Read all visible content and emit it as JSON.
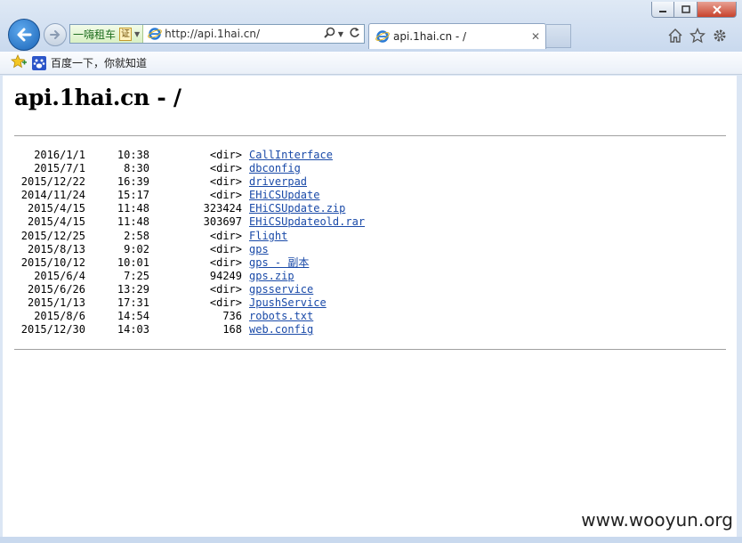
{
  "browser": {
    "address": {
      "site_badge": "一嗨租车",
      "cert_label": "证",
      "url": "http://api.1hai.cn/"
    },
    "tab": {
      "title": "api.1hai.cn - /"
    },
    "favorites": [
      {
        "label": "百度一下，你就知道"
      }
    ]
  },
  "page": {
    "heading": "api.1hai.cn - /",
    "entries": [
      {
        "date": "2016/1/1",
        "time": "10:38",
        "size": "<dir>",
        "name": "CallInterface"
      },
      {
        "date": "2015/7/1",
        "time": "8:30",
        "size": "<dir>",
        "name": "dbconfig"
      },
      {
        "date": "2015/12/22",
        "time": "16:39",
        "size": "<dir>",
        "name": "driverpad"
      },
      {
        "date": "2014/11/24",
        "time": "15:17",
        "size": "<dir>",
        "name": "EHiCSUpdate"
      },
      {
        "date": "2015/4/15",
        "time": "11:48",
        "size": "323424",
        "name": "EHiCSUpdate.zip"
      },
      {
        "date": "2015/4/15",
        "time": "11:48",
        "size": "303697",
        "name": "EHiCSUpdateold.rar"
      },
      {
        "date": "2015/12/25",
        "time": "2:58",
        "size": "<dir>",
        "name": "Flight"
      },
      {
        "date": "2015/8/13",
        "time": "9:02",
        "size": "<dir>",
        "name": "gps"
      },
      {
        "date": "2015/10/12",
        "time": "10:01",
        "size": "<dir>",
        "name": "gps - 副本"
      },
      {
        "date": "2015/6/4",
        "time": "7:25",
        "size": "94249",
        "name": "gps.zip"
      },
      {
        "date": "2015/6/26",
        "time": "13:29",
        "size": "<dir>",
        "name": "gpsservice"
      },
      {
        "date": "2015/1/13",
        "time": "17:31",
        "size": "<dir>",
        "name": "JpushService"
      },
      {
        "date": "2015/8/6",
        "time": "14:54",
        "size": "736",
        "name": "robots.txt"
      },
      {
        "date": "2015/12/30",
        "time": "14:03",
        "size": "168",
        "name": "web.config"
      }
    ]
  },
  "watermark": "www.wooyun.org",
  "colors": {
    "link": "#1a4aa8",
    "chrome": "#dbe6f4",
    "close": "#c7432c"
  }
}
